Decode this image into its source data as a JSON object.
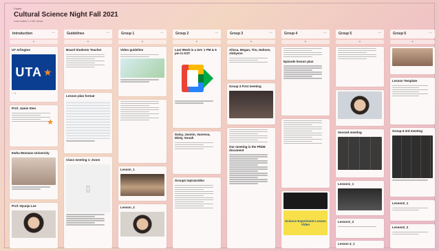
{
  "board": {
    "crumb": "Padlet",
    "title": "Cultural Science Night Fall 2021",
    "subtitle": "Last edited • 2.5K views"
  },
  "columns": [
    {
      "name": "Introduction"
    },
    {
      "name": "Guidelines"
    },
    {
      "name": "Group 1"
    },
    {
      "name": "Group 2"
    },
    {
      "name": "Group 3"
    },
    {
      "name": "Group 4"
    },
    {
      "name": "Group 5"
    },
    {
      "name": "Group 6"
    }
  ],
  "cards": {
    "intro_1": "UT Arlington",
    "intro_logo": "UTA",
    "intro_2": "Prof. Jamie Sten",
    "intro_3": "Ewha Womans University",
    "intro_4": "Prof. Hyunju Lee",
    "guide_1": "Board Students Teacher",
    "guide_2": "Lesson plan format",
    "guide_3": "Class meeting 1: Zoom",
    "g1_1": "Video guideline",
    "g1_2": "Lesson_1",
    "g1_3": "Lesson_2",
    "g2_1": "Last Week is a Set: 1 PM & 6 pm in KST",
    "g2_2": "Daisy, Jasmin, Vanessa, Misty, Sooah",
    "g2_3": "Group2 topic&video",
    "g3_1": "Alissa, Megan, Tim, Hahnee, Jinhyeon",
    "g3_2": "Group 3 First meeting",
    "g3_3": "Our meeting is the PhDE document",
    "g4_1": "Episode lesson plan",
    "g4_2": "Science Experiment Lesson Video",
    "g5_1": "Second meeting",
    "g5_2": "Lesson1_1",
    "g5_3": "Lesson1_2",
    "g5_4": "Lesson 4_1",
    "g6_1": "Lesson Template",
    "g6_2": "Group 6 3rd meeting",
    "g6_3": "Lesson2_1",
    "g6_4": "Lesson2_2"
  },
  "colors": {
    "uta_blue": "#0b3d91",
    "accent": "#f08a24"
  }
}
